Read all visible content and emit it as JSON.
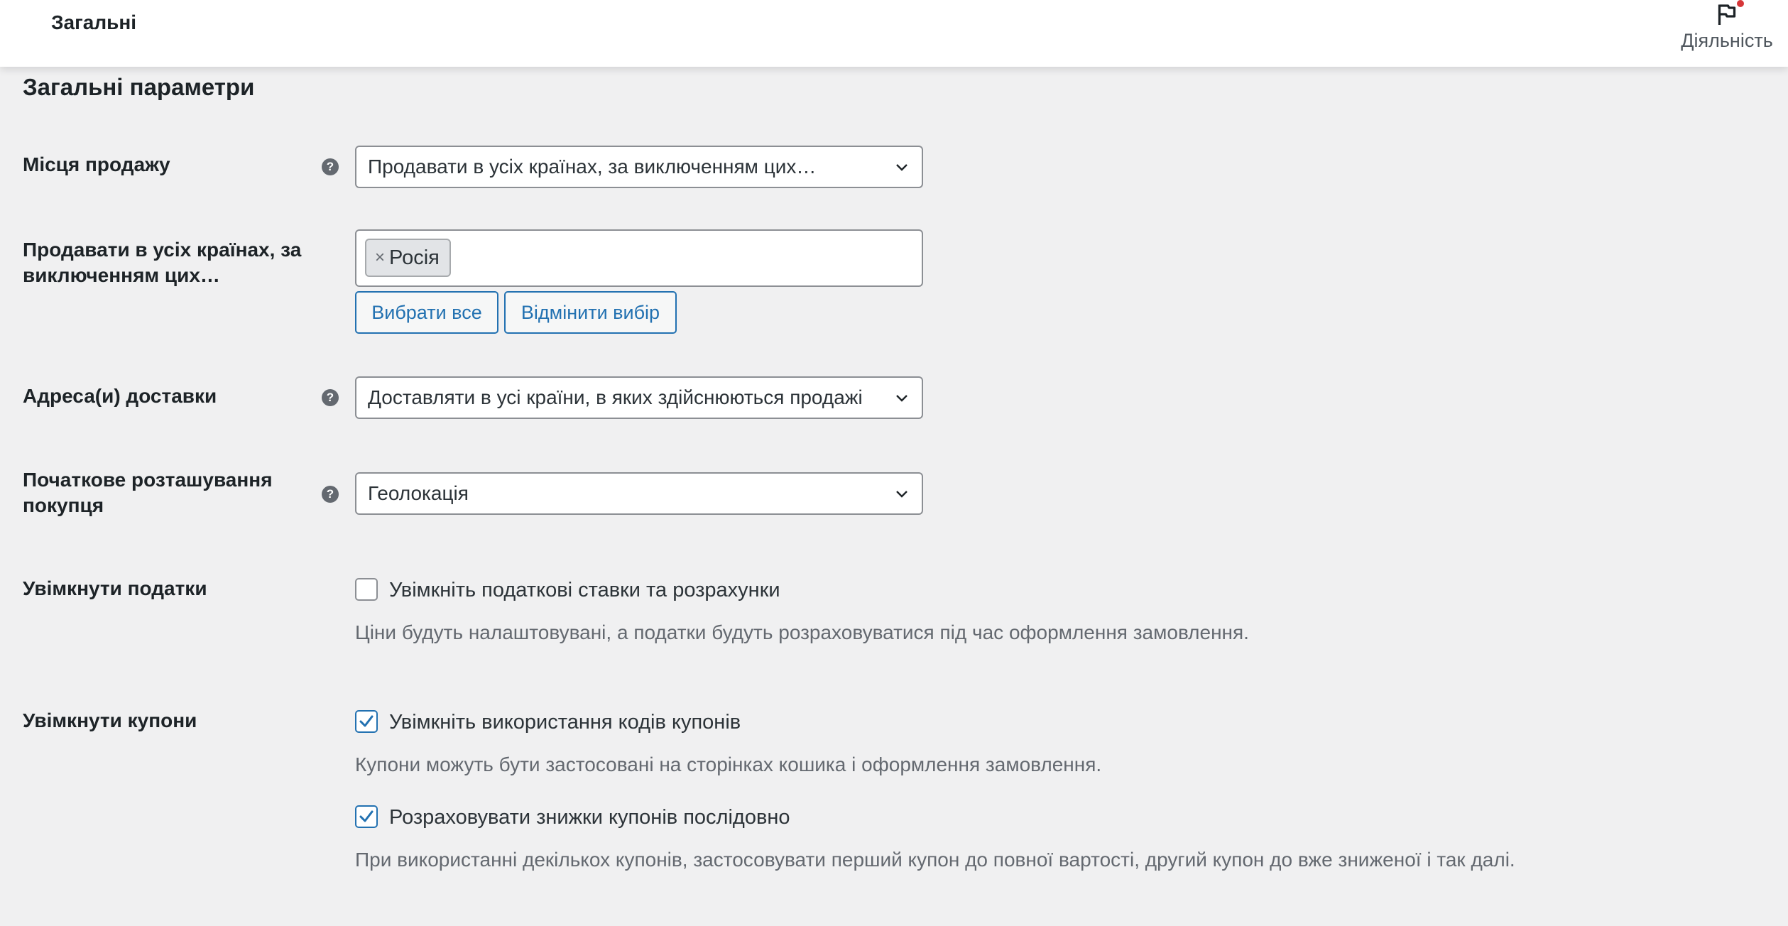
{
  "topbar": {
    "title": "Загальні",
    "activity_label": "Діяльність"
  },
  "section": {
    "title": "Загальні параметри"
  },
  "selling_location": {
    "label": "Місця продажу",
    "value": "Продавати в усіх країнах, за виключенням цих…"
  },
  "excluded_countries": {
    "label": "Продавати в усіх країнах, за виключенням цих…",
    "tags": [
      "Росія"
    ],
    "tag_remove": "×",
    "select_all_label": "Вибрати все",
    "deselect_label": "Відмінити вибір"
  },
  "shipping_locations": {
    "label": "Адреса(и) доставки",
    "value": "Доставляти в усі країни, в яких здійснюються продажі"
  },
  "default_customer_location": {
    "label": "Початкове розташування покупця",
    "value": "Геолокація"
  },
  "taxes": {
    "label": "Увімкнути податки",
    "checkbox_label": "Увімкніть податкові ставки та розрахунки",
    "checked": false,
    "description": "Ціни будуть налаштовувані, а податки будуть розраховуватися під час оформлення замовлення."
  },
  "coupons": {
    "label": "Увімкнути купони",
    "enable_label": "Увімкніть використання кодів купонів",
    "enable_checked": true,
    "enable_description": "Купони можуть бути застосовані на сторінках кошика і оформлення замовлення.",
    "sequential_label": "Розраховувати знижки купонів послідовно",
    "sequential_checked": true,
    "sequential_description": "При використанні декількох купонів, застосовувати перший купон до повної вартості, другий купон до вже зниженої і так далі."
  },
  "colors": {
    "accent": "#2271b1",
    "notification": "#d63638",
    "background": "#f0f0f1"
  }
}
